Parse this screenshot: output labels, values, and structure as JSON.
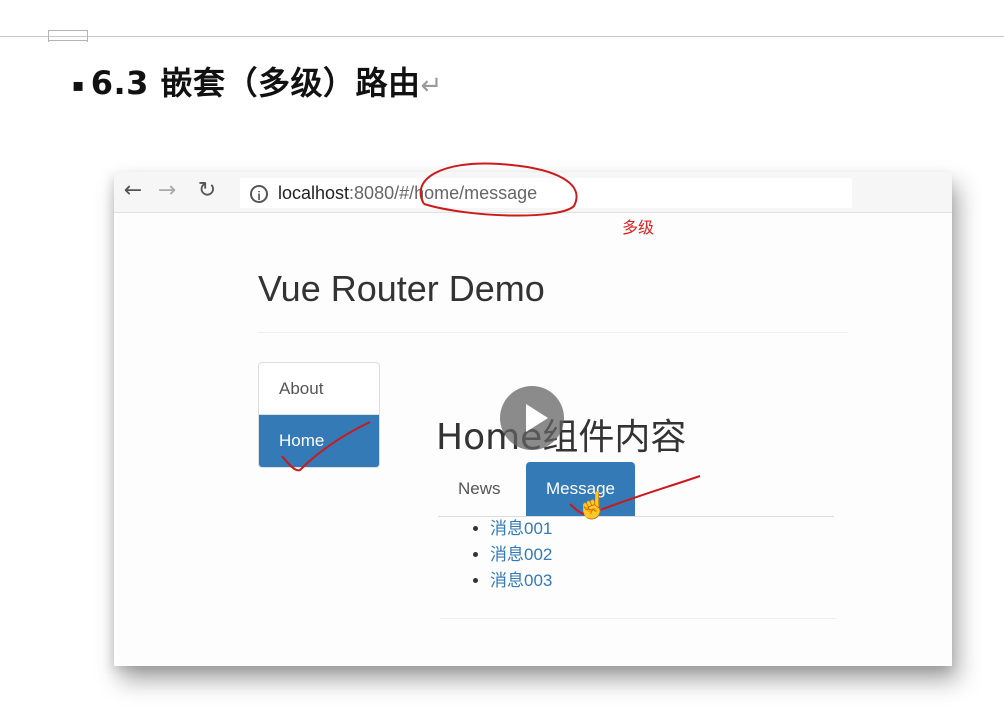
{
  "document": {
    "bullet": "▪",
    "heading": "6.3  嵌套（多级）路由",
    "paragraph_mark": "↵",
    "annotation_note": "多级"
  },
  "browser": {
    "back_icon": "arrow-left-icon",
    "forward_icon": "arrow-right-icon",
    "reload_icon": "reload-icon",
    "info_icon": "info-icon",
    "url_host": "localhost",
    "url_rest": ":8080/#/home/message"
  },
  "app": {
    "title": "Vue Router Demo",
    "nav": [
      {
        "label": "About",
        "active": false
      },
      {
        "label": "Home",
        "active": true
      }
    ],
    "home_heading": "Home组件内容",
    "tabs": [
      {
        "label": "News",
        "active": false
      },
      {
        "label": "Message",
        "active": true
      }
    ],
    "messages": [
      "消息001",
      "消息002",
      "消息003"
    ]
  },
  "colors": {
    "primary": "#337ab7",
    "annotation": "#cc1a1a"
  }
}
